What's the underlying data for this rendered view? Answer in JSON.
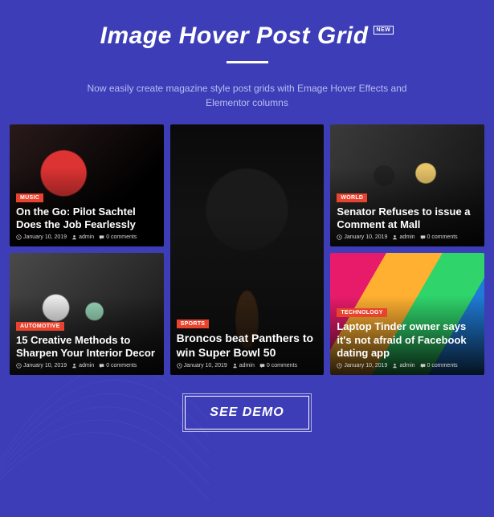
{
  "header": {
    "title": "Image Hover Post Grid",
    "badge": "NEW",
    "subtitle": "Now easily create magazine style post grids with Emage Hover Effects and Elementor columns"
  },
  "meta_labels": {
    "date": "January 10, 2019",
    "author": "admin",
    "comments": "0 comments"
  },
  "cards": {
    "guitar": {
      "category": "MUSIC",
      "title": "On the Go: Pilot Sachtel Does the Job Fearlessly"
    },
    "car": {
      "category": "AUTOMOTIVE",
      "title": "15 Creative Methods to Sharpen Your Interior Decor"
    },
    "football": {
      "category": "SPORTS",
      "title": "Broncos beat Panthers to win Super Bowl 50"
    },
    "press": {
      "category": "WORLD",
      "title": "Senator Refuses to issue a Comment at Mall"
    },
    "keyboard": {
      "category": "TECHNOLOGY",
      "title": "Laptop Tinder owner says it's not afraid of Facebook dating app"
    }
  },
  "cta": {
    "label": "SEE DEMO"
  }
}
